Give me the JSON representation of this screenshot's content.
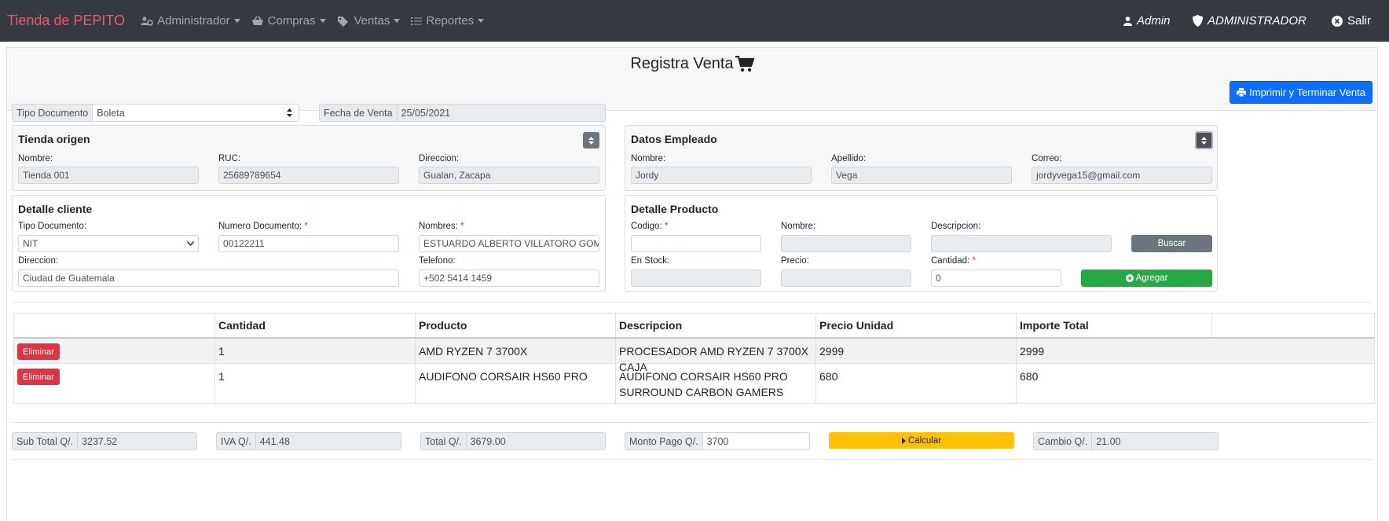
{
  "navbar": {
    "brand": "Tienda de PEPITO",
    "menus": [
      {
        "label": "Administrador",
        "icon": "users-cog-icon"
      },
      {
        "label": "Compras",
        "icon": "shopping-basket-icon"
      },
      {
        "label": "Ventas",
        "icon": "tags-icon"
      },
      {
        "label": "Reportes",
        "icon": "tasks-icon"
      }
    ],
    "user": "Admin",
    "role": "ADMINISTRADOR",
    "logout": "Salir"
  },
  "header": {
    "title": "Registra Venta",
    "print_button": "Imprimir y Terminar Venta"
  },
  "doc": {
    "tipo_label": "Tipo Documento",
    "tipo_value": "Boleta",
    "fecha_label": "Fecha de Venta",
    "fecha_value": "25/05/2021"
  },
  "tienda": {
    "title": "Tienda origen",
    "nombre_label": "Nombre:",
    "nombre": "Tienda 001",
    "ruc_label": "RUC:",
    "ruc": "25689789654",
    "direccion_label": "Direccion:",
    "direccion": "Gualan, Zacapa"
  },
  "empleado": {
    "title": "Datos Empleado",
    "nombre_label": "Nombre:",
    "nombre": "Jordy",
    "apellido_label": "Apellido:",
    "apellido": "Vega",
    "correo_label": "Correo:",
    "correo": "jordyvega15@gmail.com"
  },
  "cliente": {
    "title": "Detalle cliente",
    "tipo_label": "Tipo Documento:",
    "tipo": "NIT",
    "numero_label": "Numero Documento:",
    "numero": "00122211",
    "nombres_label": "Nombres:",
    "nombres": "ESTUARDO ALBERTO VILLATORO GOMEZ",
    "direccion_label": "Direccion:",
    "direccion": "Ciudad de Guatemala",
    "telefono_label": "Telefono:",
    "telefono": "+502 5414 1459"
  },
  "producto": {
    "title": "Detalle Producto",
    "codigo_label": "Codigo:",
    "codigo": "",
    "nombre_label": "Nombre:",
    "nombre": "",
    "descripcion_label": "Descripcion:",
    "descripcion": "",
    "buscar": "Buscar",
    "stock_label": "En Stock:",
    "stock": "",
    "precio_label": "Precio:",
    "precio": "",
    "cantidad_label": "Cantidad:",
    "cantidad": "0",
    "agregar": "Agregar"
  },
  "table": {
    "headers": [
      "",
      "Cantidad",
      "Producto",
      "Descripcion",
      "Precio Unidad",
      "Importe Total"
    ],
    "delete_label": "Eliminar",
    "rows": [
      {
        "cantidad": "1",
        "producto": "AMD RYZEN 7 3700X",
        "descripcion": "PROCESADOR AMD RYZEN 7 3700X CAJA",
        "precio": "2999",
        "importe": "2999"
      },
      {
        "cantidad": "1",
        "producto": "AUDIFONO CORSAIR HS60 PRO",
        "descripcion": "AUDIFONO CORSAIR HS60 PRO SURROUND CARBON GAMERS",
        "precio": "680",
        "importe": "680"
      }
    ]
  },
  "totales": {
    "subtotal_label": "Sub Total Q/.",
    "subtotal": "3237.52",
    "iva_label": "IVA Q/.",
    "iva": "441.48",
    "total_label": "Total Q/.",
    "total": "3679.00",
    "monto_label": "Monto Pago Q/.",
    "monto": "3700",
    "calcular": "Calcular",
    "cambio_label": "Cambio Q/.",
    "cambio": "21.00"
  }
}
